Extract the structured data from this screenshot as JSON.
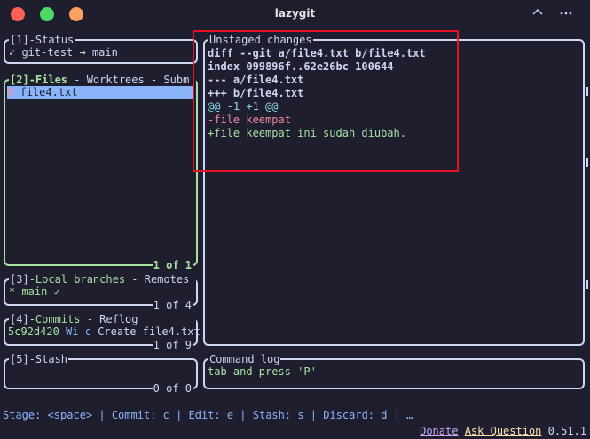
{
  "window": {
    "title": "lazygit",
    "colors": {
      "close": "#ff5f57",
      "minimize": "#4cd964",
      "maximize": "#ff9f60"
    },
    "icons": [
      "chevron-up-icon",
      "more-horizontal-icon"
    ]
  },
  "status": {
    "title": "[1]-Status",
    "text": "✓ git-test → main"
  },
  "files": {
    "title_num": "[2]-",
    "title_active": "Files",
    "title_rest": " - Worktrees - Subm",
    "items": [
      {
        "marker": "M",
        "name": "file4.txt"
      }
    ],
    "footer": "1 of 1"
  },
  "branches": {
    "title_num": "[3]-",
    "title_active": "Local branches",
    "title_rest": " - Remotes",
    "item_prefix": "* ",
    "item_name": "main",
    "item_check": " ✓",
    "footer": "1 of 4"
  },
  "commits": {
    "title_num": "[4]-",
    "title_active": "Commits",
    "title_rest": " - Reflog",
    "item_hash": "5c92d420",
    "item_author": "Wi",
    "item_mark": "c",
    "item_msg": "Create file4.txt",
    "footer": "1 of 9"
  },
  "stash": {
    "title": "[5]-Stash",
    "footer": "0 of 0"
  },
  "unstaged": {
    "title": "Unstaged changes",
    "lines": {
      "l1": "diff --git a/file4.txt b/file4.txt",
      "l2": "index 099896f..62e26bc 100644",
      "l3": "--- a/file4.txt",
      "l4": "+++ b/file4.txt",
      "l5": "@@ -1 +1 @@",
      "l6": "-file keempat",
      "l7": "+file keempat ini sudah diubah."
    }
  },
  "command_log": {
    "title": "Command log",
    "text": "tab and press 'P'"
  },
  "statusbar": {
    "keys": "Stage: <space> | Commit: c | Edit: e | Stash: s | Discard: d | …",
    "donate": "Donate",
    "ask": "Ask Question",
    "version": "0.51.1"
  }
}
